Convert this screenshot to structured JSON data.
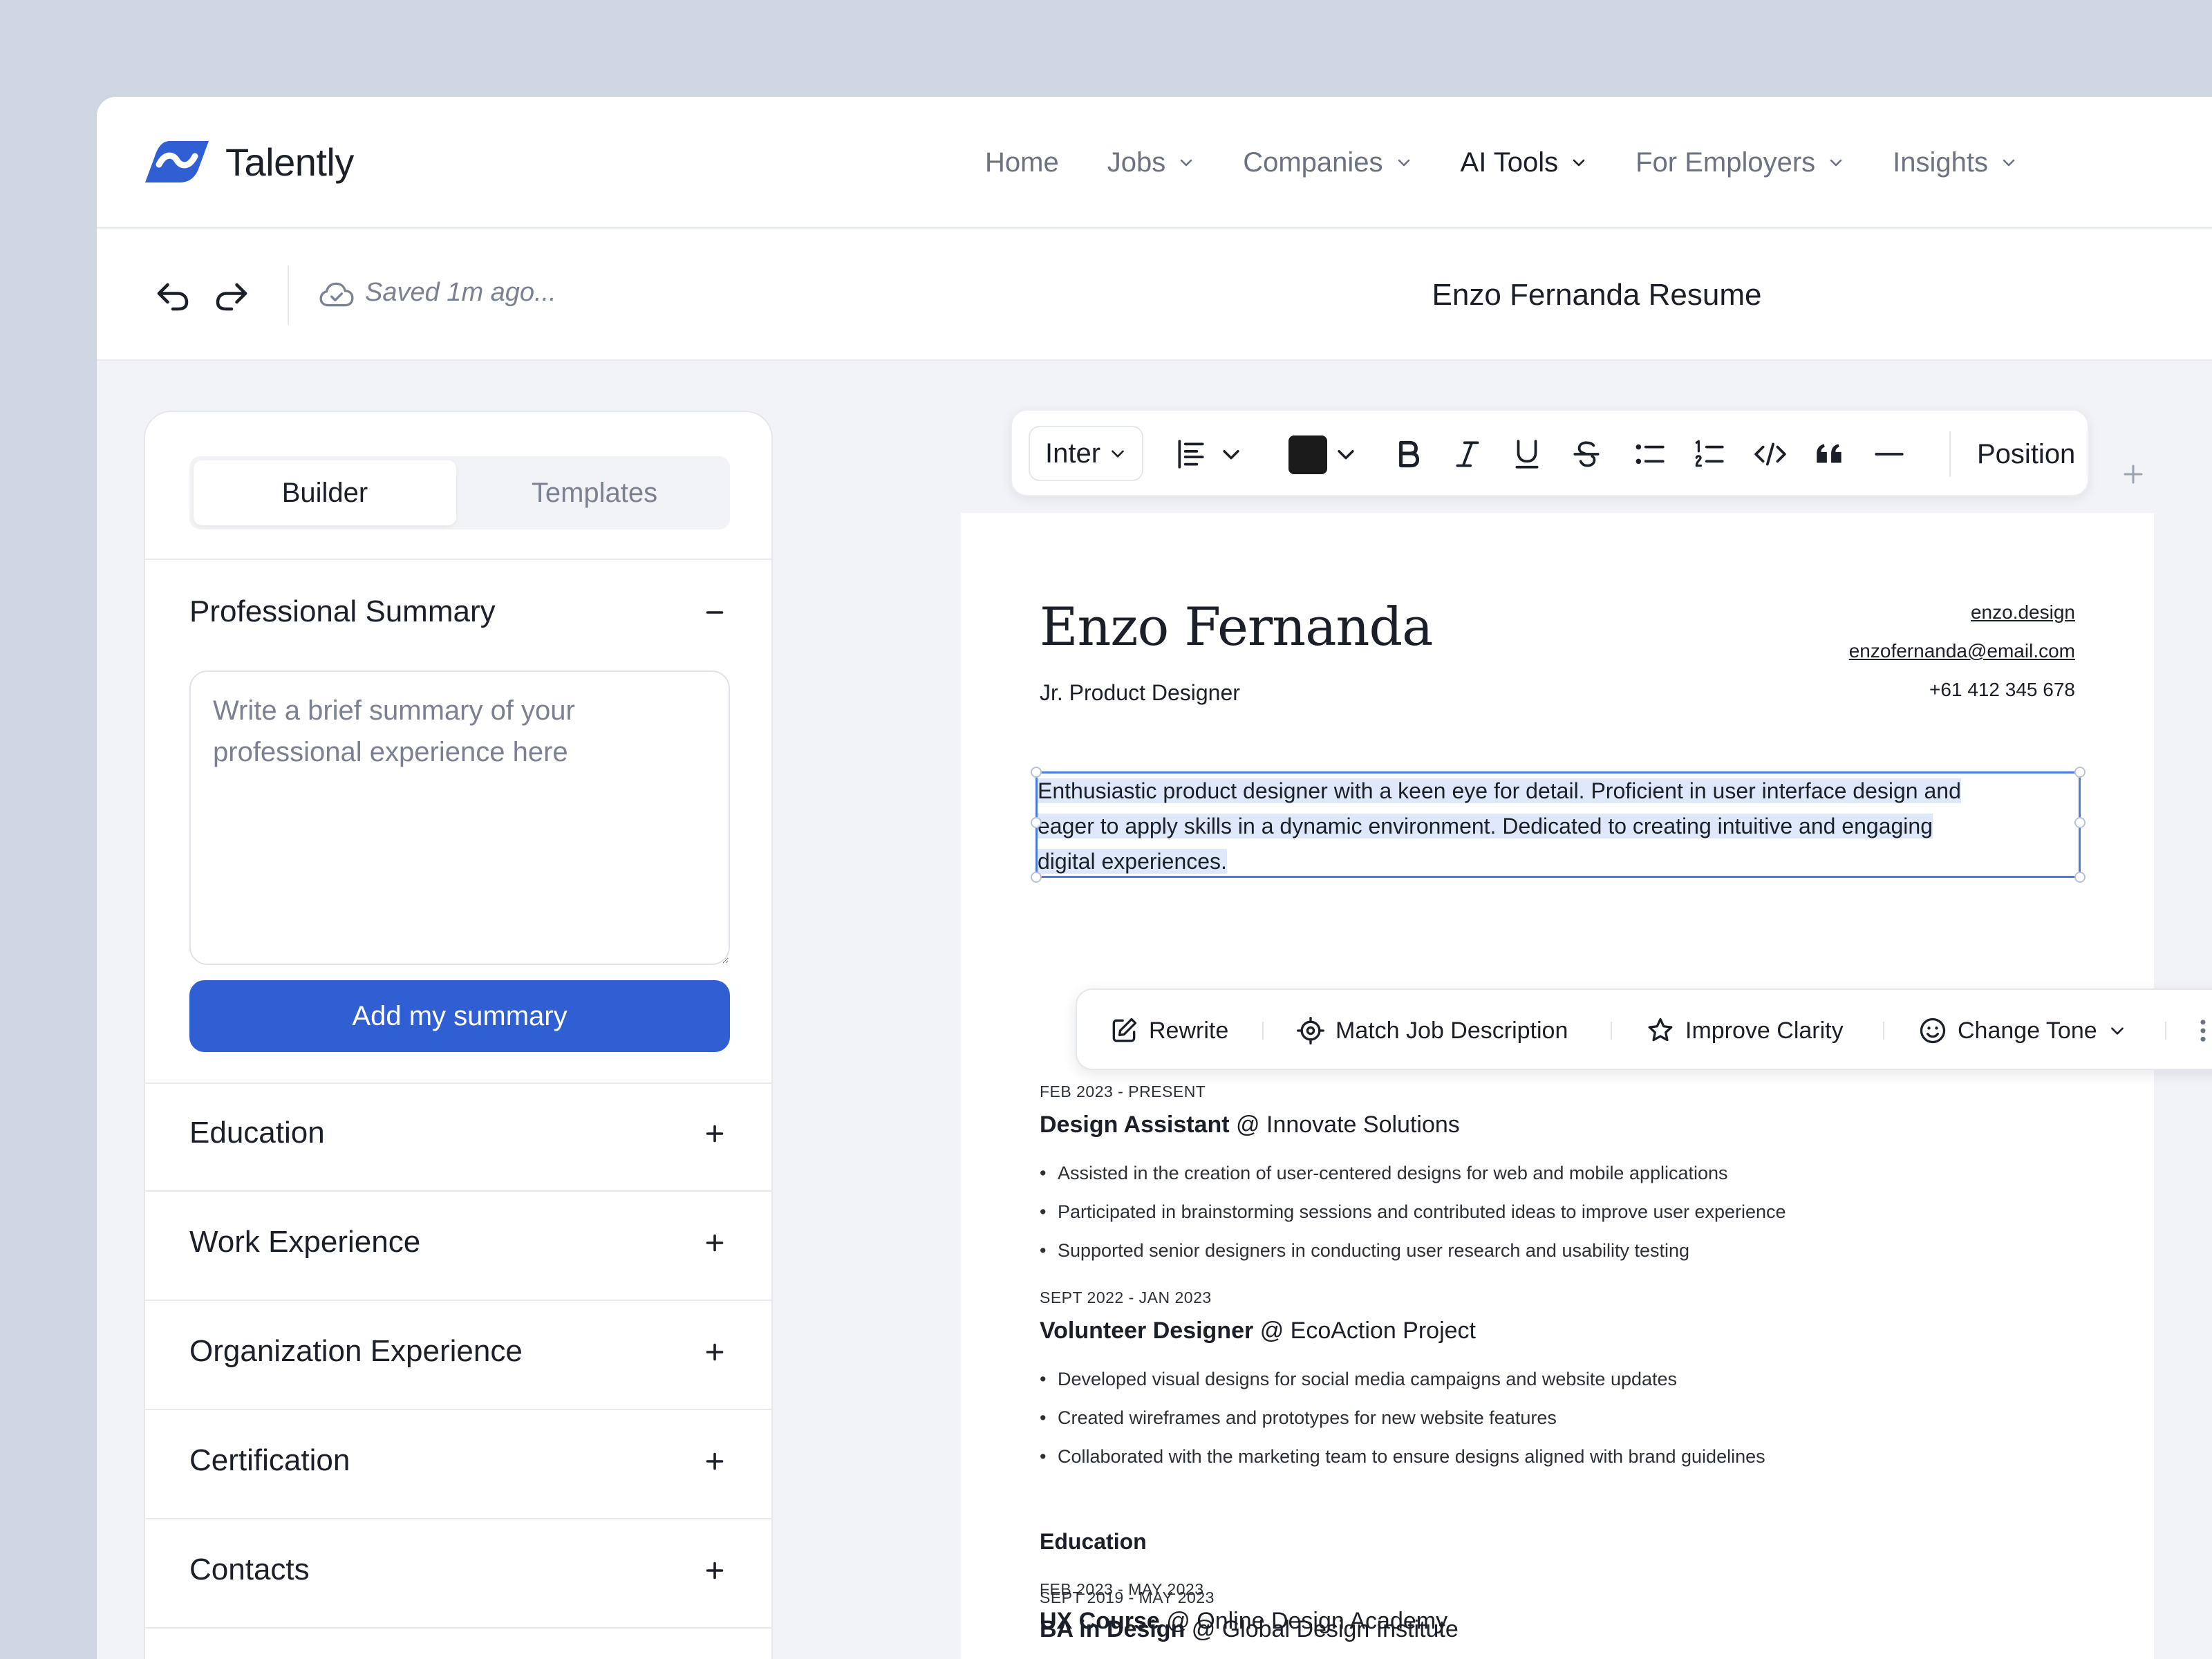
{
  "app": {
    "name": "Talently",
    "brand_color": "#2f5fd3"
  },
  "nav": {
    "items": [
      {
        "label": "Home",
        "has_dropdown": false,
        "active": false
      },
      {
        "label": "Jobs",
        "has_dropdown": true,
        "active": false
      },
      {
        "label": "Companies",
        "has_dropdown": true,
        "active": false
      },
      {
        "label": "AI Tools",
        "has_dropdown": true,
        "active": true
      },
      {
        "label": "For Employers",
        "has_dropdown": true,
        "active": false
      },
      {
        "label": "Insights",
        "has_dropdown": true,
        "active": false
      }
    ]
  },
  "doc_header": {
    "saved_status": "Saved 1m ago...",
    "title": "Enzo Fernanda Resume",
    "icons": [
      "undo-icon",
      "redo-icon",
      "cloud-icon"
    ]
  },
  "panel": {
    "tabs": [
      {
        "label": "Builder",
        "active": true
      },
      {
        "label": "Templates",
        "active": false
      }
    ],
    "summary": {
      "title": "Professional Summary",
      "placeholder": "Write a brief summary of your professional experience here",
      "value": "",
      "button": "Add my summary",
      "expanded": true
    },
    "sections": [
      {
        "title": "Education"
      },
      {
        "title": "Work Experience"
      },
      {
        "title": "Organization Experience"
      },
      {
        "title": "Certification"
      },
      {
        "title": "Contacts"
      }
    ]
  },
  "toolbar": {
    "font": "Inter",
    "text_color": "#1b1b1b",
    "position_label": "Position",
    "icons": [
      "align-icon",
      "bold-icon",
      "italic-icon",
      "underline-icon",
      "strikethrough-icon",
      "bullet-list-icon",
      "numbered-list-icon",
      "code-icon",
      "quote-icon",
      "divider-icon"
    ]
  },
  "ai_actions": {
    "items": [
      {
        "label": "Rewrite",
        "icon": "edit-icon"
      },
      {
        "label": "Match Job Description",
        "icon": "target-icon"
      },
      {
        "label": "Improve Clarity",
        "icon": "star-icon"
      },
      {
        "label": "Change Tone",
        "icon": "smile-icon",
        "has_dropdown": true
      }
    ]
  },
  "resume": {
    "name": "Enzo Fernanda",
    "role": "Jr. Product Designer",
    "contacts": {
      "website": "enzo.design",
      "email": "enzofernanda@email.com",
      "phone": "+61 412 345 678"
    },
    "summary_lines": [
      "Enthusiastic product designer with a keen eye for detail. Proficient in user interface design and",
      "eager to apply skills in a dynamic environment. Dedicated to creating intuitive and engaging",
      "digital experiences."
    ],
    "experience": [
      {
        "date": "FEB 2023 - PRESENT",
        "title": "Design Assistant",
        "company": "@ Innovate Solutions",
        "bullets": [
          "Assisted in the creation of user-centered designs for web and mobile applications",
          "Participated in brainstorming sessions and contributed ideas to improve user experience",
          "Supported senior designers in conducting user research and usability testing"
        ]
      },
      {
        "date": "SEPT 2022 - JAN 2023",
        "title": "Volunteer Designer",
        "company": "@ EcoAction Project",
        "bullets": [
          "Developed visual designs for social media campaigns and website updates",
          "Created wireframes and prototypes for new website features",
          "Collaborated with the marketing team to ensure designs aligned with brand guidelines"
        ]
      }
    ],
    "education_heading": "Education",
    "education": [
      {
        "date": "SEPT 2019 - MAY 2023",
        "title": "BA in Design",
        "school": "@ Global Design Institute"
      },
      {
        "date": "FEB 2023 - MAY 2023",
        "title": "UX Course",
        "school": "@ Online Design Academy"
      }
    ]
  }
}
